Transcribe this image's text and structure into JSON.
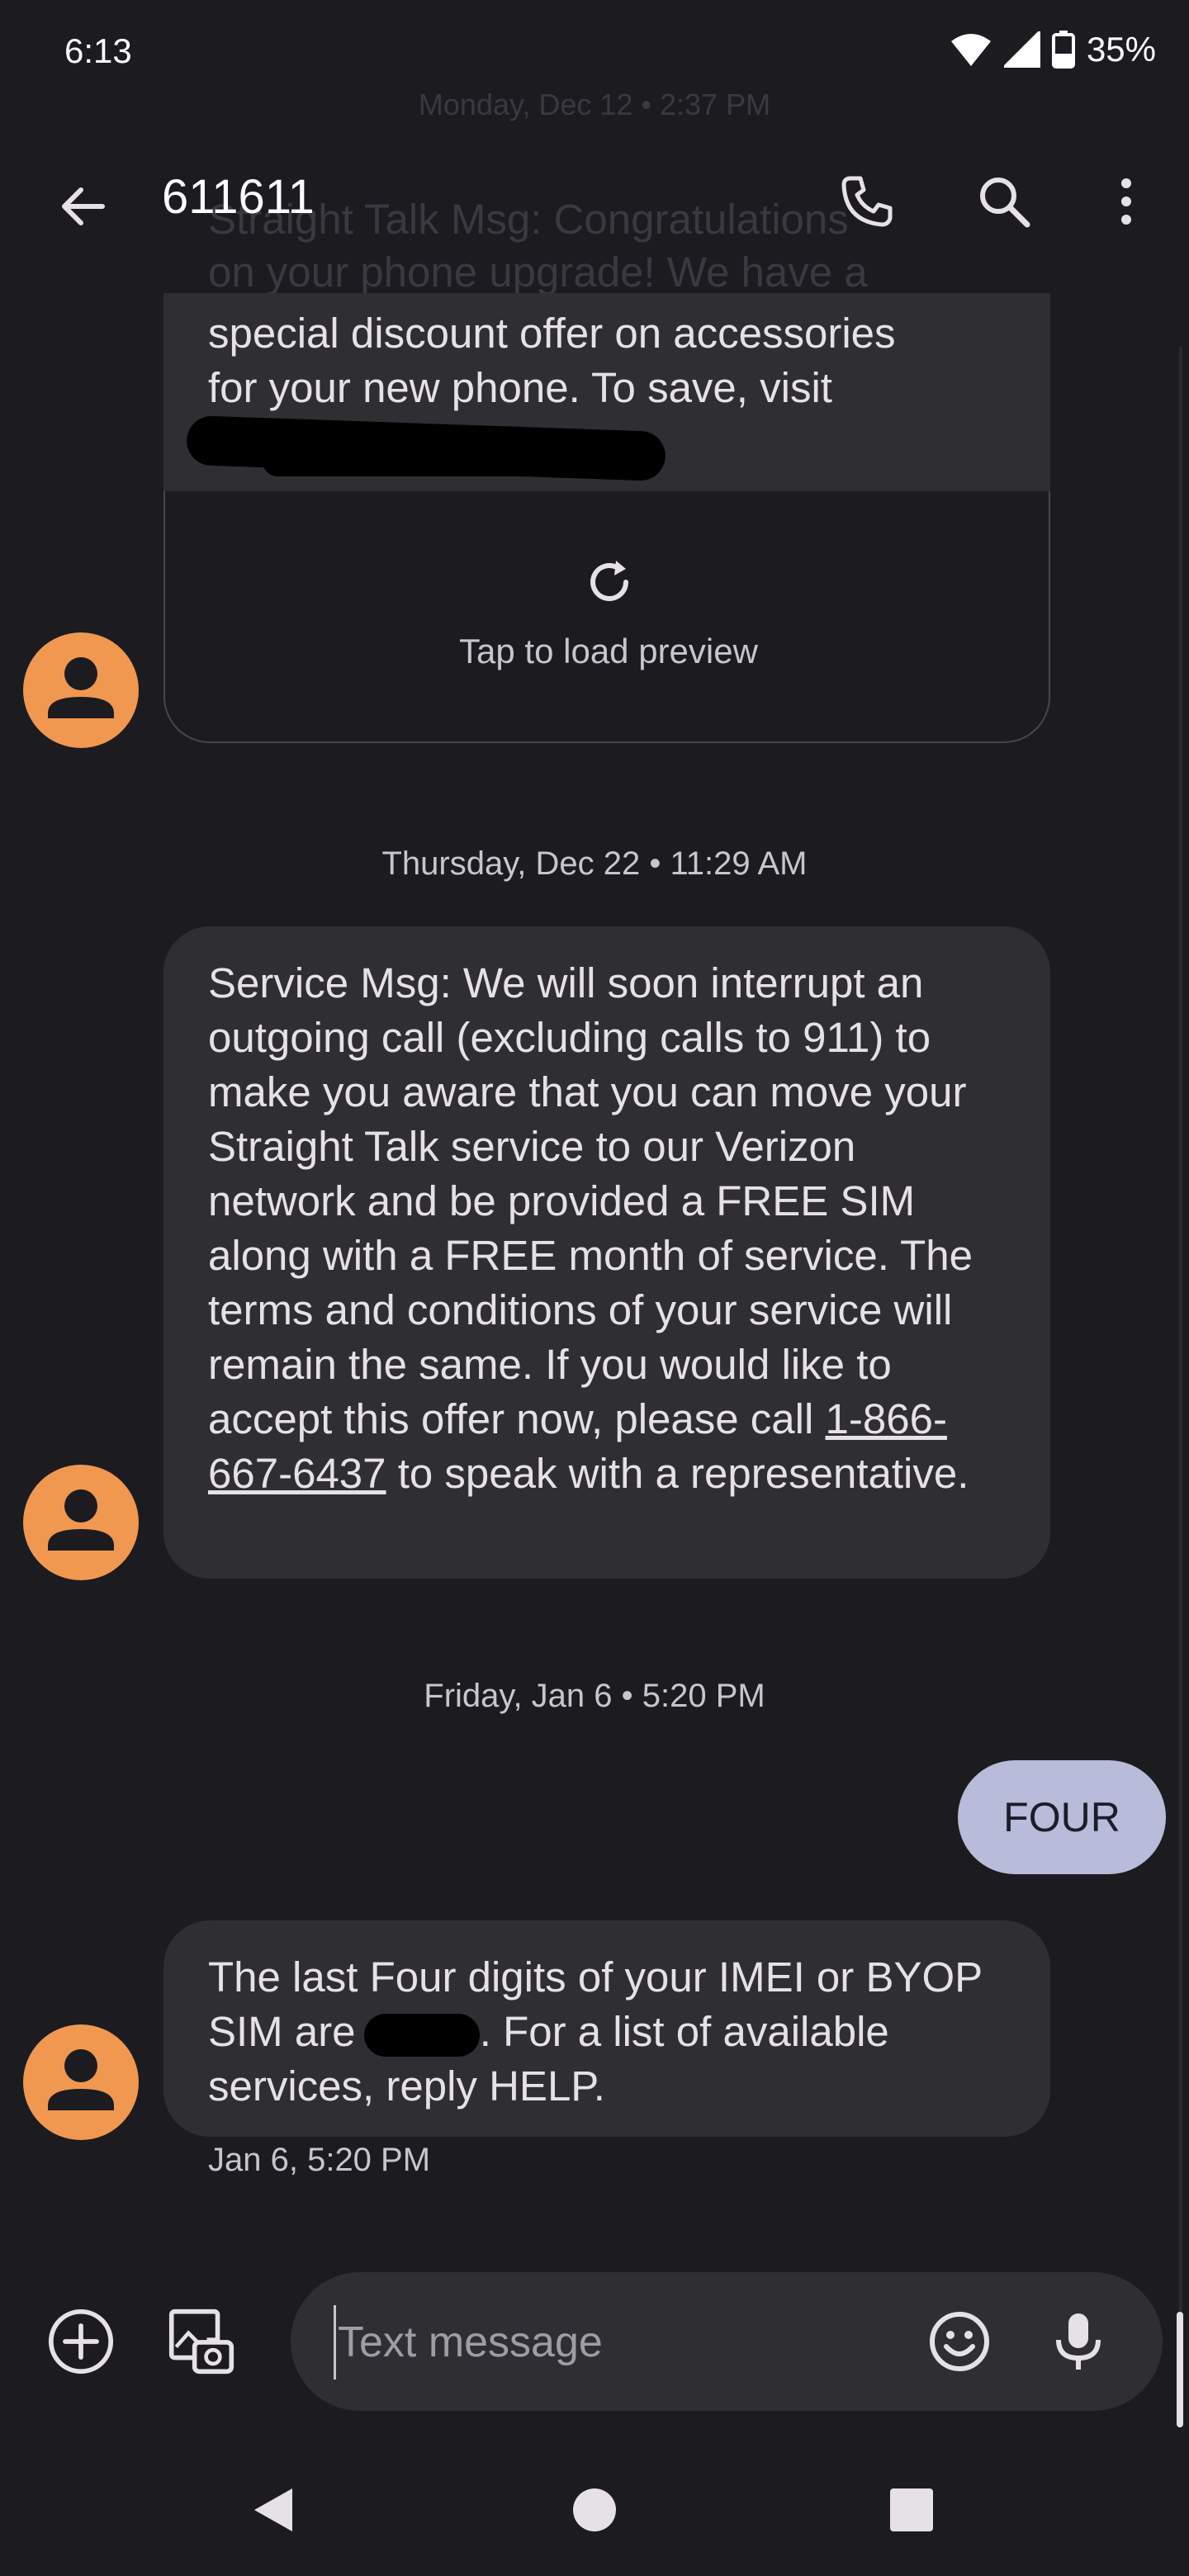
{
  "status_bar": {
    "time": "6:13",
    "battery": "35%"
  },
  "header": {
    "title": "611611",
    "ghost_timestamp": "Monday, Dec 12 • 2:37 PM",
    "ghost_line1": "Straight Talk Msg: Congratulations",
    "ghost_line2": "on your phone upgrade! We have a"
  },
  "messages": {
    "prev_partial": "special discount offer on accessories\nfor your new phone. To save, visit\n                                   STOP to end",
    "preview_label": "Tap to load preview",
    "date1": "Thursday, Dec 22 • 11:29 AM",
    "service_part1": "Service Msg: We will soon interrupt an outgoing call (excluding calls to 911) to make you aware that you can move your Straight Talk service to our Verizon network and be provided a FREE SIM along with a FREE month of service. The terms and conditions of your service will remain the same. If you would like to accept this offer now, please call ",
    "service_phone": "1-866-667-6437",
    "service_part2": " to speak with a representative.",
    "date2": "Friday, Jan 6 • 5:20 PM",
    "sent_text": "FOUR",
    "reply_part1": "The last Four digits of your IMEI or BYOP SIM are ",
    "reply_part2": ". For a list of available services, reply HELP.",
    "reply_time": "Jan 6, 5:20 PM"
  },
  "composer": {
    "placeholder": "Text message"
  },
  "colors": {
    "avatar": "#f0984f",
    "bubble": "#2f2f33",
    "sent_bubble": "#b8bbd9",
    "background": "#1c1b20"
  }
}
